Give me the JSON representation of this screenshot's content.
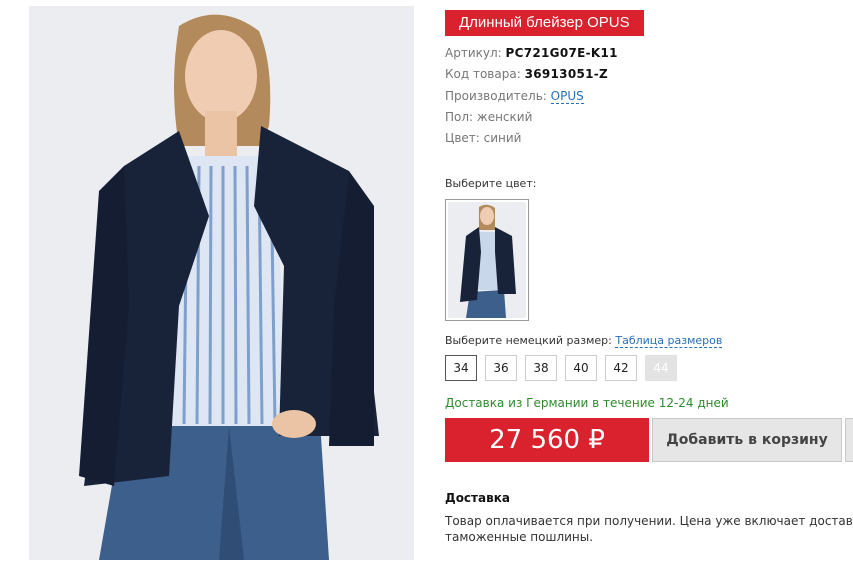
{
  "product": {
    "title": "Длинный блейзер OPUS",
    "article_label": "Артикул:",
    "article_value": "PC721G07E-K11",
    "code_label": "Код товара:",
    "code_value": "36913051-Z",
    "maker_label": "Производитель:",
    "maker_value": "OPUS",
    "gender": "Пол: женский",
    "color": "Цвет: синий"
  },
  "color_select": {
    "label": "Выберите цвет:"
  },
  "size_select": {
    "label": "Выберите немецкий размер:",
    "table_link": "Таблица размеров",
    "sizes": [
      "34",
      "36",
      "38",
      "40",
      "42",
      "44"
    ],
    "selected": "34",
    "unavailable": [
      "44"
    ]
  },
  "delivery_note": "Доставка из Германии в течение 12-24 дней",
  "price": "27 560 ₽",
  "cart_button": "Добавить в корзину",
  "delivery": {
    "heading": "Доставка",
    "text_line1": "Товар оплачивается при получении. Цена уже включает доставк",
    "text_line2": "таможенные пошлины."
  },
  "colors": {
    "accent": "#d9222e",
    "link": "#2a6fb5",
    "success": "#2e8b2e"
  }
}
